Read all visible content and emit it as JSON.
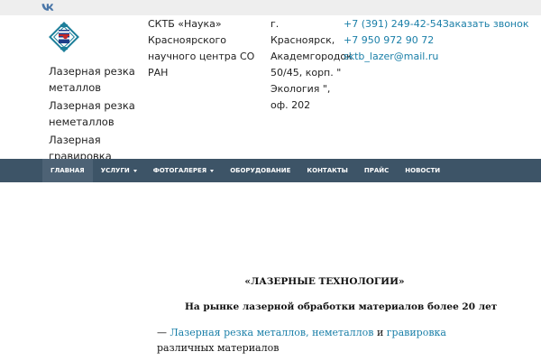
{
  "header": {
    "social": {
      "icon": "vk-icon"
    },
    "logo": {
      "icon": "sktb-logo-icon"
    },
    "taglines": [
      "Лазерная резка металлов",
      "Лазерная резка неметаллов",
      "Лазерная гравировка"
    ],
    "org_name": "СКТБ «Наука» Красноярского научного центра СО РАН",
    "address": "г. Красноярск, Академгородок 50/45, корп. \" Экология \", оф. 202",
    "phone1": "+7 (391) 249-42-54",
    "callback_label": "Заказать звонок",
    "phone2": "+7 950 972 90 72",
    "email": "sktb_lazer@mail.ru"
  },
  "nav": {
    "items": [
      {
        "label": "ГЛАВНАЯ",
        "active": true
      },
      {
        "label": "УСЛУГИ",
        "dropdown": true
      },
      {
        "label": "ФОТОГАЛЕРЕЯ",
        "dropdown": true
      },
      {
        "label": "ОБОРУДОВАНИЕ"
      },
      {
        "label": "КОНТАКТЫ"
      },
      {
        "label": "ПРАЙС"
      },
      {
        "label": "НОВОСТИ"
      }
    ]
  },
  "content": {
    "title": "«ЛАЗЕРНЫЕ ТЕХНОЛОГИИ»",
    "subtitle": "На рынке лазерной обработки материалов более 20 лет",
    "dash": "— ",
    "link_metals": "Лазерная резка металлов",
    "comma": ", ",
    "link_nonmetals": "неметаллов",
    "and": " и ",
    "link_engraving": "гравировка",
    "rest": "  различных материалов"
  },
  "colors": {
    "nav_bg": "#3d5467",
    "nav_active": "#4d6275",
    "link": "#1a7fa8",
    "topbar": "#eeeeee"
  }
}
